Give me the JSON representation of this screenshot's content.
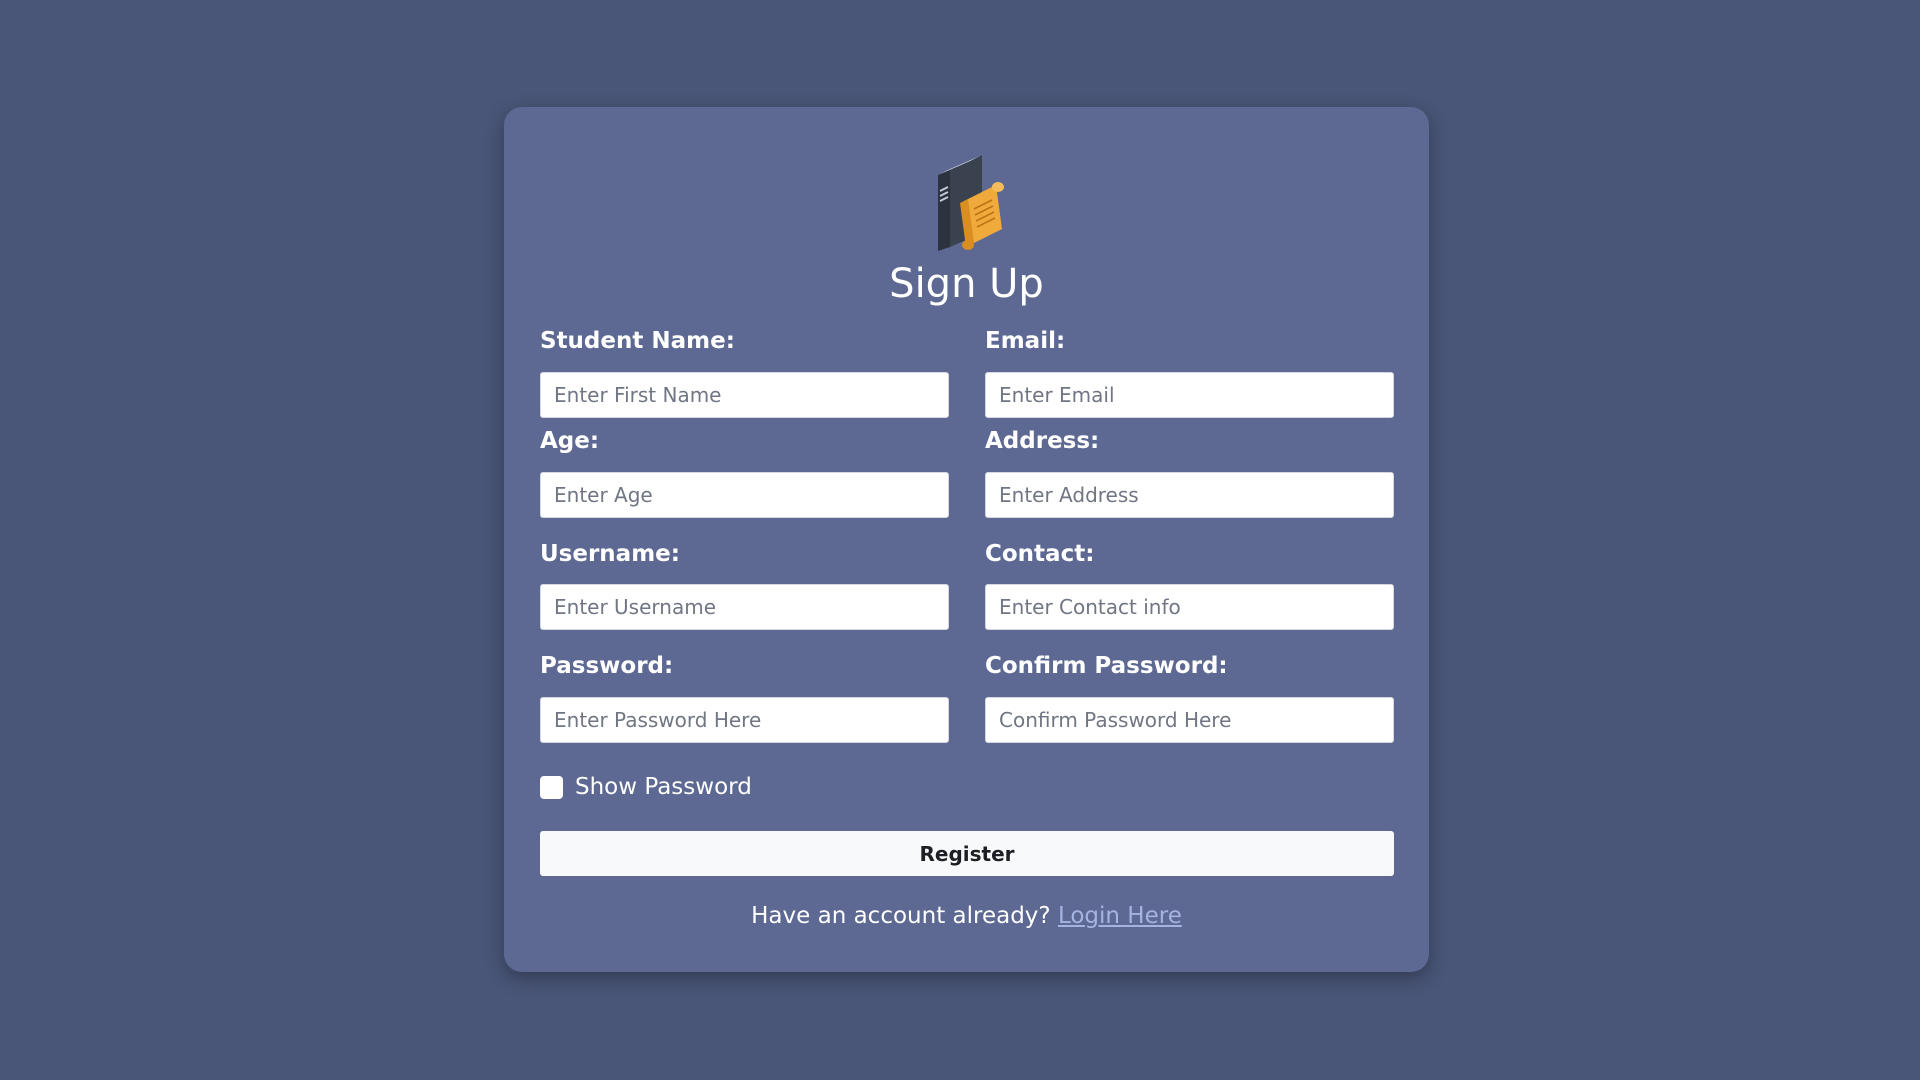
{
  "page": {
    "title": "Sign Up"
  },
  "logo": {
    "icon": "book-scroll-icon",
    "colors": {
      "book": "#3a4250",
      "book_light": "#4d5766",
      "scroll": "#f0a93b"
    }
  },
  "form": {
    "student_name": {
      "label": "Student Name:",
      "placeholder": "Enter First Name"
    },
    "email": {
      "label": "Email:",
      "placeholder": "Enter Email"
    },
    "age": {
      "label": "Age:",
      "placeholder": "Enter Age"
    },
    "address": {
      "label": "Address:",
      "placeholder": "Enter Address"
    },
    "username": {
      "label": "Username:",
      "placeholder": "Enter Username"
    },
    "contact": {
      "label": "Contact:",
      "placeholder": "Enter Contact info"
    },
    "password": {
      "label": "Password:",
      "placeholder": "Enter Password Here"
    },
    "confirm_password": {
      "label": "Confirm Password:",
      "placeholder": "Confirm Password Here"
    },
    "show_password": {
      "label": "Show Password",
      "checked": false
    },
    "register_label": "Register"
  },
  "footer": {
    "text": "Have an account already?",
    "link_label": "Login Here"
  },
  "colors": {
    "background": "#4a5677",
    "card": "#5d6992",
    "link": "#a5b3e0"
  }
}
